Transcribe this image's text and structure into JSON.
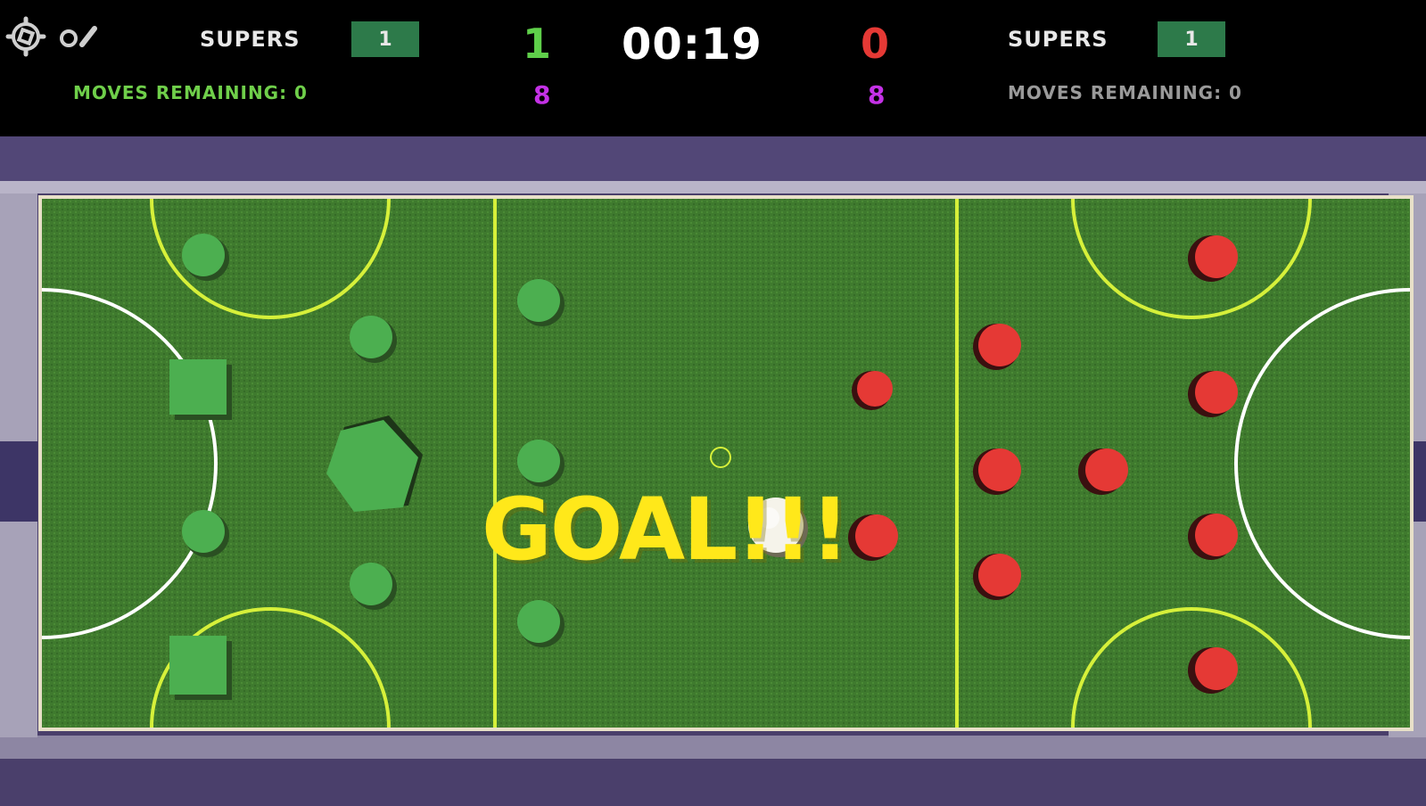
{
  "hud": {
    "left": {
      "supers_label": "SUPERS",
      "supers_count": "1",
      "moves_label": "MOVES REMAINING: 0",
      "score": "1",
      "sub_count": "8"
    },
    "right": {
      "supers_label": "SUPERS",
      "supers_count": "1",
      "moves_label": "MOVES REMAINING: 0",
      "score": "0",
      "sub_count": "8"
    },
    "timer": "00:19",
    "controls": {
      "settings_icon": "gear-icon",
      "sound_icon": "sound-toggle-icon"
    }
  },
  "field": {
    "banner": "GOAL!!!",
    "colors": {
      "grass": "#3f7a2e",
      "line_yellow": "#d6f03a",
      "line_white": "#ffffff",
      "team_left": "#4caf50",
      "team_right": "#e53935",
      "ball": "#f5f3ea",
      "score_left": "#4caf50",
      "score_right": "#e53935",
      "sub_count": "#c431e6"
    }
  }
}
